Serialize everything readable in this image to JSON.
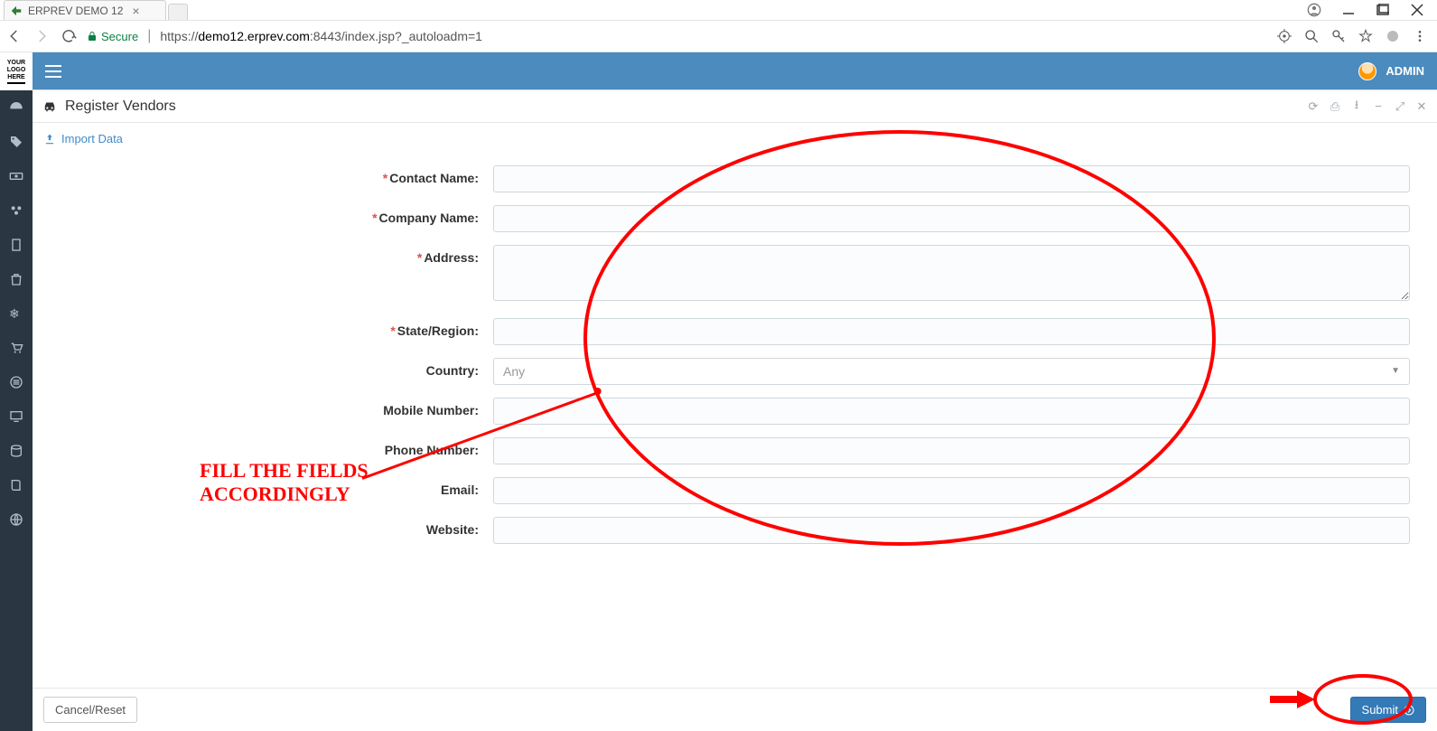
{
  "browser": {
    "tab_title": "ERPREV DEMO 12",
    "secure_label": "Secure",
    "url_prefix": "https://",
    "url_host": "demo12.erprev.com",
    "url_port_path": ":8443/index.jsp?_autoloadm=1"
  },
  "topbar": {
    "user_label": "ADMIN"
  },
  "sidebar": {
    "logo_line1": "YOUR",
    "logo_line2": "LOGO",
    "logo_line3": "HERE",
    "items": [
      {
        "icon": "dashboard"
      },
      {
        "icon": "tag"
      },
      {
        "icon": "cash"
      },
      {
        "icon": "vendors"
      },
      {
        "icon": "doc"
      },
      {
        "icon": "trash"
      },
      {
        "icon": "snowflake"
      },
      {
        "icon": "cart"
      },
      {
        "icon": "music"
      },
      {
        "icon": "monitor"
      },
      {
        "icon": "database"
      },
      {
        "icon": "book"
      },
      {
        "icon": "globe"
      }
    ]
  },
  "panel": {
    "title": "Register Vendors",
    "import_label": "Import Data"
  },
  "form": {
    "fields": {
      "contact_name": {
        "label": "Contact Name:",
        "required": true,
        "value": ""
      },
      "company_name": {
        "label": "Company Name:",
        "required": true,
        "value": ""
      },
      "address": {
        "label": "Address:",
        "required": true,
        "value": ""
      },
      "state_region": {
        "label": "State/Region:",
        "required": true,
        "value": ""
      },
      "country": {
        "label": "Country:",
        "required": false,
        "selected": "Any"
      },
      "mobile": {
        "label": "Mobile Number:",
        "required": false,
        "value": ""
      },
      "phone": {
        "label": "Phone Number:",
        "required": false,
        "value": ""
      },
      "email": {
        "label": "Email:",
        "required": false,
        "value": ""
      },
      "website": {
        "label": "Website:",
        "required": false,
        "value": ""
      }
    }
  },
  "footer": {
    "cancel_label": "Cancel/Reset",
    "submit_label": "Submit"
  },
  "annotation": {
    "text_line1": "FILL THE FIELDS",
    "text_line2": "ACCORDINGLY"
  }
}
